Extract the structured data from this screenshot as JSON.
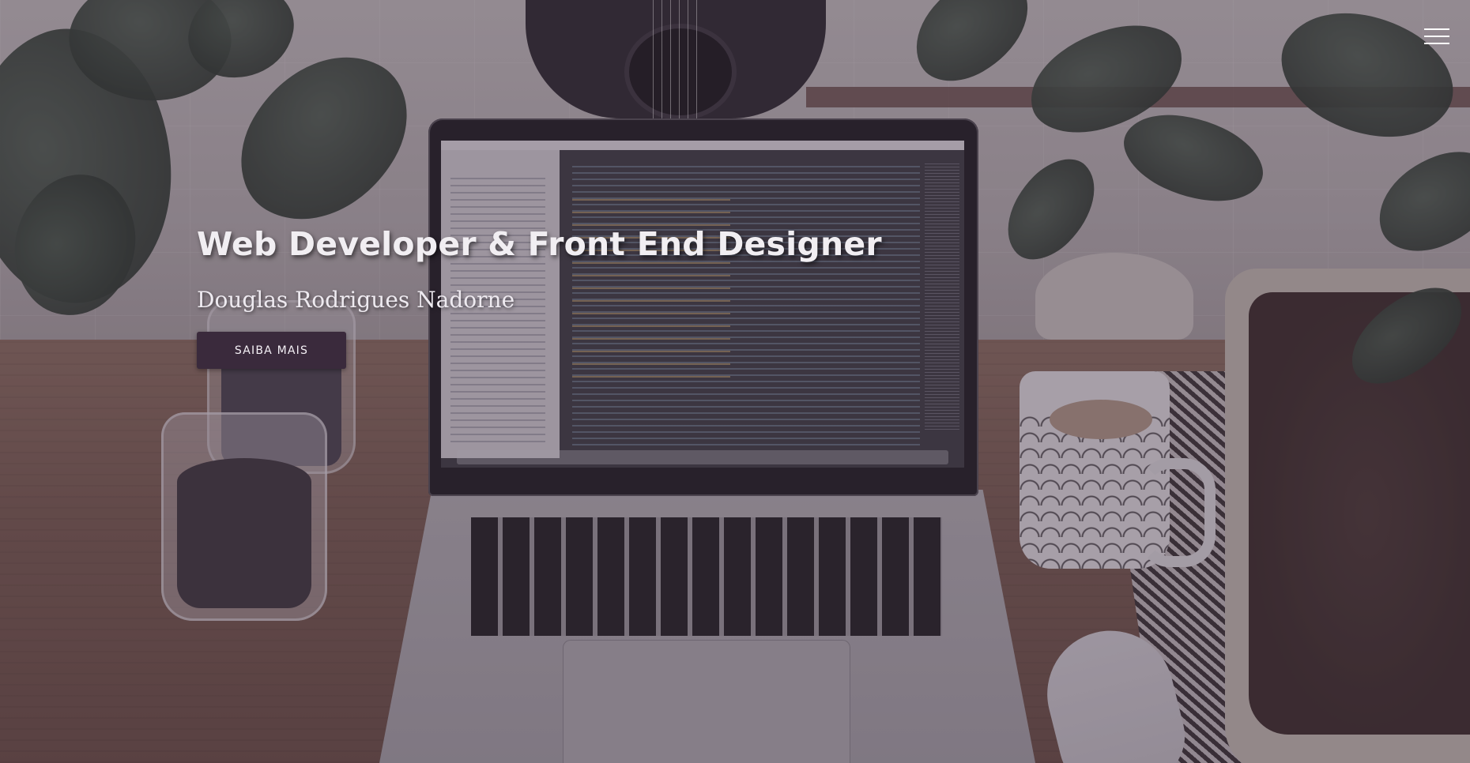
{
  "hero": {
    "title": "Web Developer & Front End Designer",
    "subtitle": "Douglas Rodrigues Nadorne",
    "cta_label": "SAIBA MAIS"
  },
  "nav": {
    "menu_icon": "hamburger-menu-icon"
  },
  "colors": {
    "overlay": "#3c2d3c",
    "button_bg": "#3a2a3c",
    "title_text": "#f1eef2"
  }
}
